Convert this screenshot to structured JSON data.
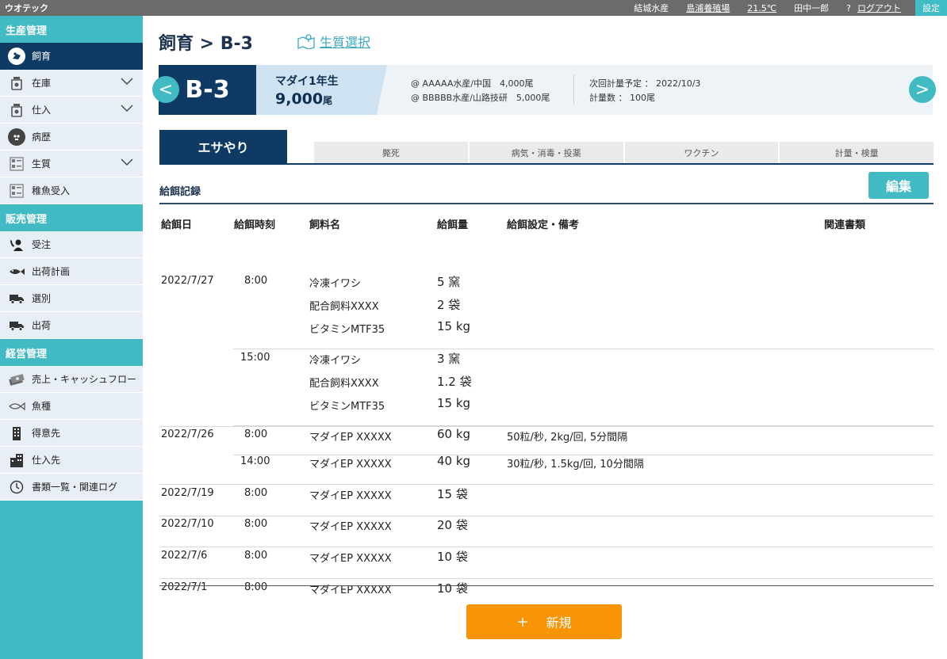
{
  "topbar": {
    "brand": "ウオテック",
    "company": "結城水産",
    "farm": "島浦養殖場",
    "temp": "21.5℃",
    "user": "田中一郎",
    "help": "?",
    "logout": "ログアウト",
    "settings": "設定"
  },
  "sidebar": {
    "production": {
      "title": "生産管理",
      "items": [
        {
          "label": "飼育",
          "icon": "fish-feeding-icon"
        },
        {
          "label": "在庫",
          "icon": "stock-jar-icon"
        },
        {
          "label": "仕入",
          "icon": "purchase-jar-icon"
        },
        {
          "label": "病歴",
          "icon": "skull-icon"
        },
        {
          "label": "生質",
          "icon": "quality-grid-icon"
        },
        {
          "label": "稚魚受入",
          "icon": "fry-grid-icon"
        }
      ]
    },
    "sales": {
      "title": "販売管理",
      "items": [
        {
          "label": "受注",
          "icon": "phone-user-icon"
        },
        {
          "label": "出荷計画",
          "icon": "fish-icon"
        },
        {
          "label": "選別",
          "icon": "truck-icon"
        },
        {
          "label": "出荷",
          "icon": "truck-icon"
        }
      ]
    },
    "management": {
      "title": "経営管理",
      "items": [
        {
          "label": "売上・キャッシュフロー",
          "icon": "money-icon"
        },
        {
          "label": "魚種",
          "icon": "fish-outline-icon"
        },
        {
          "label": "得意先",
          "icon": "building-icon"
        },
        {
          "label": "仕入先",
          "icon": "buildings-icon"
        },
        {
          "label": "書類一覧・関連ログ",
          "icon": "clock-icon"
        }
      ]
    }
  },
  "header": {
    "title": "飼育 > B-3",
    "quality_link": "生質選択"
  },
  "banner": {
    "code": "B-3",
    "species": "マダイ1年生",
    "count": "9,000",
    "count_unit": "尾",
    "source1": "@ AAAAA水産/中国　4,000尾",
    "source2": "@ BBBBB水産/山路技研　5,000尾",
    "next_measure": "次回計量予定 ： 2022/10/3",
    "measure_count": "計量数 ： 100尾",
    "prev": "<",
    "next": ">"
  },
  "tabs": {
    "active": "エサやり",
    "others": [
      "斃死",
      "病気・消毒・投薬",
      "ワクチン",
      "計量・検量"
    ]
  },
  "section": {
    "title": "給餌記録",
    "edit": "編集"
  },
  "table": {
    "headers": {
      "date": "給餌日",
      "time": "給餌時刻",
      "feed": "飼料名",
      "qty": "給餌量",
      "note": "給餌設定・備考",
      "docs": "関連書類"
    }
  },
  "rows": [
    {
      "date": "2022/7/27",
      "time": "8:00",
      "feed": "冷凍イワシ",
      "qty": "5 窯",
      "note": ""
    },
    {
      "date": "",
      "time": "",
      "feed": "配合飼料XXXX",
      "qty": "2 袋",
      "note": ""
    },
    {
      "date": "",
      "time": "",
      "feed": "ビタミンMTF35",
      "qty": "15 kg",
      "note": ""
    },
    {
      "date": "",
      "time": "15:00",
      "feed": "冷凍イワシ",
      "qty": "3 窯",
      "note": ""
    },
    {
      "date": "",
      "time": "",
      "feed": "配合飼料XXXX",
      "qty": "1.2 袋",
      "note": ""
    },
    {
      "date": "",
      "time": "",
      "feed": "ビタミンMTF35",
      "qty": "15 kg",
      "note": ""
    },
    {
      "date": "2022/7/26",
      "time": "8:00",
      "feed": "マダイEP XXXXX",
      "qty": "60 kg",
      "note": "50粒/秒, 2kg/回, 5分間隔"
    },
    {
      "date": "",
      "time": "14:00",
      "feed": "マダイEP XXXXX",
      "qty": "40 kg",
      "note": "30粒/秒, 1.5kg/回, 10分間隔"
    },
    {
      "date": "2022/7/19",
      "time": "8:00",
      "feed": "マダイEP XXXXX",
      "qty": "15 袋",
      "note": ""
    },
    {
      "date": "2022/7/10",
      "time": "8:00",
      "feed": "マダイEP XXXXX",
      "qty": "20 袋",
      "note": ""
    },
    {
      "date": "2022/7/6",
      "time": "8:00",
      "feed": "マダイEP XXXXX",
      "qty": "10 袋",
      "note": ""
    },
    {
      "date": "2022/7/1",
      "time": "8:00",
      "feed": "マダイEP XXXXX",
      "qty": "10 袋",
      "note": ""
    }
  ],
  "actions": {
    "new_plus": "+",
    "new_label": "新規"
  },
  "colors": {
    "navy": "#0f3a63",
    "teal": "#41bac4",
    "orange": "#f89406"
  }
}
